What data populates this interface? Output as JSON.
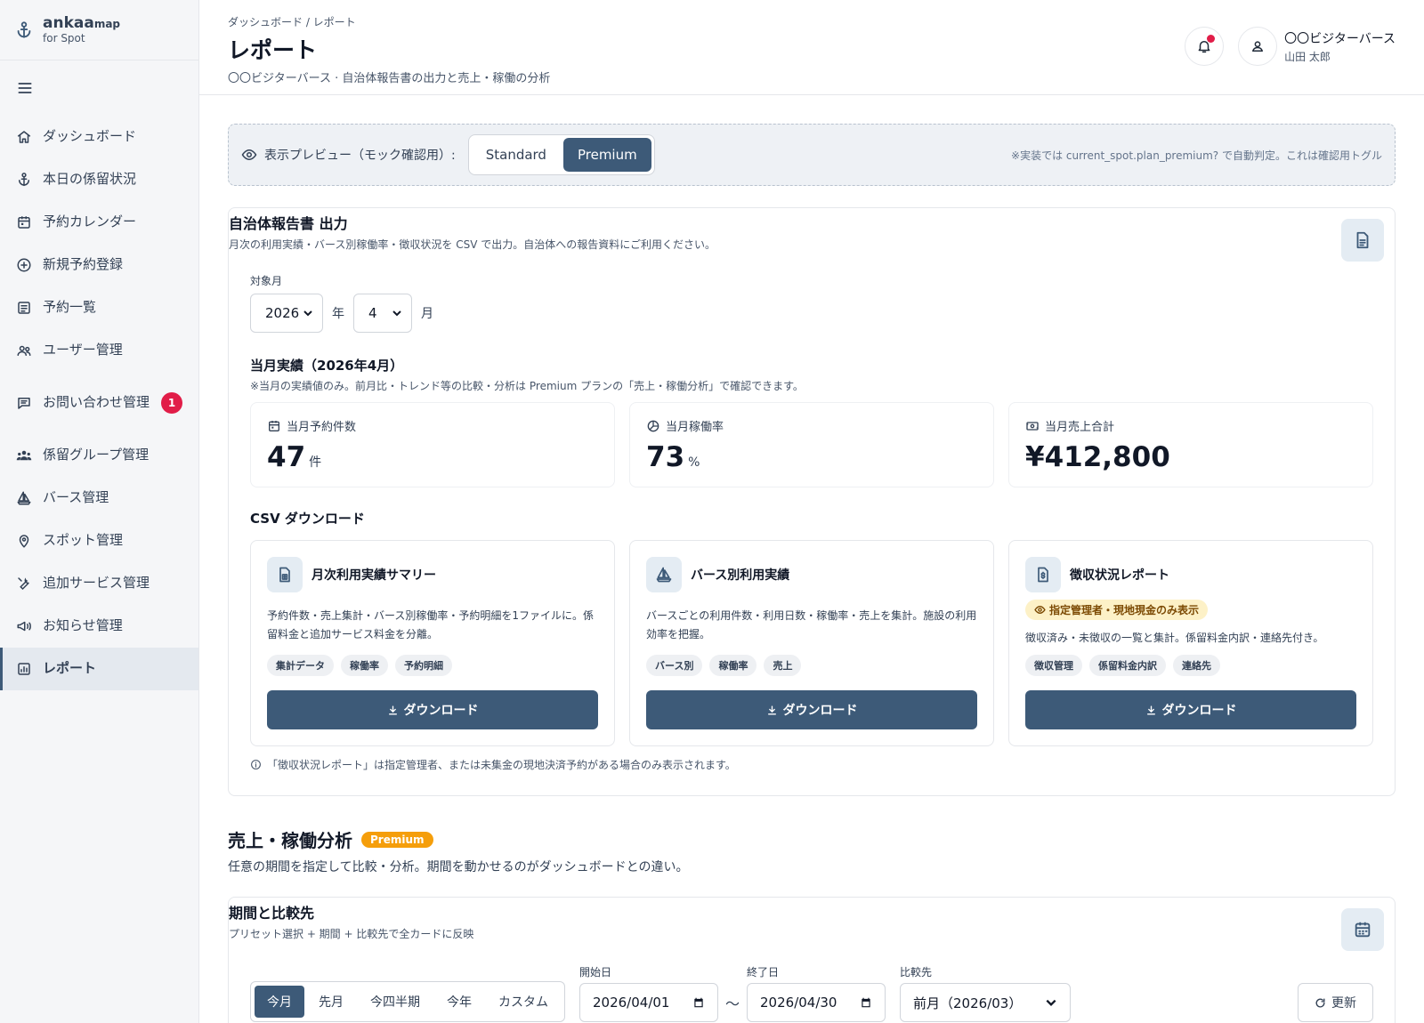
{
  "brand": {
    "name": "ankaa",
    "name_suffix": "map",
    "sub": "for Spot"
  },
  "sidebar": {
    "items": [
      {
        "label": "ダッシュボード",
        "icon": "home-icon"
      },
      {
        "label": "本日の係留状況",
        "icon": "anchor-icon"
      },
      {
        "label": "予約カレンダー",
        "icon": "calendar-icon"
      },
      {
        "label": "新規予約登録",
        "icon": "plus-circle-icon"
      },
      {
        "label": "予約一覧",
        "icon": "list-icon"
      },
      {
        "label": "ユーザー管理",
        "icon": "users-icon"
      },
      {
        "label": "お問い合わせ管理",
        "icon": "message-icon",
        "badge": "1"
      },
      {
        "label": "係留グループ管理",
        "icon": "group-icon"
      },
      {
        "label": "バース管理",
        "icon": "sailboat-icon"
      },
      {
        "label": "スポット管理",
        "icon": "map-pin-icon"
      },
      {
        "label": "追加サービス管理",
        "icon": "tool-icon"
      },
      {
        "label": "お知らせ管理",
        "icon": "megaphone-icon"
      },
      {
        "label": "レポート",
        "icon": "report-icon",
        "active": true
      }
    ]
  },
  "header": {
    "breadcrumb": "ダッシュボード / レポート",
    "title": "レポート",
    "subtitle": "〇〇ビジターバース · 自治体報告書の出力と売上・稼働の分析",
    "user_name": "〇〇ビジターバース",
    "user_sub": "山田 太郎"
  },
  "preview": {
    "label": "表示プレビュー（モック確認用）:",
    "standard": "Standard",
    "premium": "Premium",
    "note": "※実装では current_spot.plan_premium? で自動判定。これは確認用トグル"
  },
  "report": {
    "title": "自治体報告書 出力",
    "desc": "月次の利用実績・バース別稼働率・徴収状況を CSV で出力。自治体への報告資料にご利用ください。",
    "target_label": "対象月",
    "year": "2026",
    "year_unit": "年",
    "month": "4",
    "month_unit": "月",
    "summary_title": "当月実績（2026年4月）",
    "summary_note": "※当月の実績値のみ。前月比・トレンド等の比較・分析は Premium プランの「売上・稼働分析」で確認できます。",
    "kpis": [
      {
        "label": "当月予約件数",
        "value": "47",
        "unit": "件"
      },
      {
        "label": "当月稼働率",
        "value": "73",
        "unit": "%"
      },
      {
        "label": "当月売上合計",
        "value": "¥412,800",
        "unit": ""
      }
    ],
    "csv_title": "CSV ダウンロード",
    "downloads": [
      {
        "title": "月次利用実績サマリー",
        "desc": "予約件数・売上集計・バース別稼働率・予約明細を1ファイルに。係留料金と追加サービス料金を分離。",
        "tags": [
          "集計データ",
          "稼働率",
          "予約明細"
        ],
        "button": "ダウンロード"
      },
      {
        "title": "バース別利用実績",
        "desc": "バースごとの利用件数・利用日数・稼働率・売上を集計。施設の利用効率を把握。",
        "tags": [
          "バース別",
          "稼働率",
          "売上"
        ],
        "button": "ダウンロード"
      },
      {
        "title": "徴収状況レポート",
        "warn": "指定管理者・現地現金のみ表示",
        "desc": "徴収済み・未徴収の一覧と集計。係留料金内訳・連絡先付き。",
        "tags": [
          "徴収管理",
          "係留料金内訳",
          "連絡先"
        ],
        "button": "ダウンロード"
      }
    ],
    "footnote": "「徴収状況レポート」は指定管理者、または未集金の現地決済予約がある場合のみ表示されます。"
  },
  "analysis": {
    "title": "売上・稼働分析",
    "badge": "Premium",
    "subtitle": "任意の期間を指定して比較・分析。期間を動かせるのがダッシュボードとの違い。",
    "period_title": "期間と比較先",
    "period_desc": "プリセット選択 + 期間 + 比較先で全カードに反映",
    "presets": [
      "今月",
      "先月",
      "今四半期",
      "今年",
      "カスタム"
    ],
    "start_label": "開始日",
    "start": "2026/04/01",
    "end_label": "終了日",
    "end": "2026/04/30",
    "tilde": "〜",
    "compare_label": "比較先",
    "compare": "前月（2026/03）",
    "refresh": "更新"
  }
}
